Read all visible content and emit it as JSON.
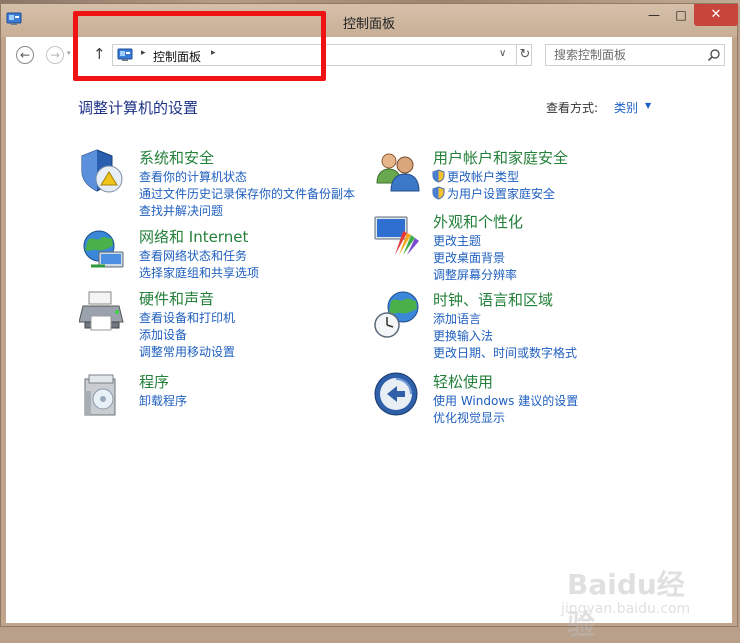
{
  "window": {
    "title": "控制面板",
    "minimize": "—",
    "maximize": "□",
    "close": "✕"
  },
  "navbar": {
    "back": "←",
    "forward": "→",
    "recent": "▾",
    "up": "↑",
    "breadcrumb": "控制面板",
    "separator": "▸",
    "dropdown": "∨",
    "refresh": "↻",
    "search_placeholder": "搜索控制面板"
  },
  "main": {
    "heading": "调整计算机的设置",
    "view_by_label": "查看方式:",
    "view_by_value": "类别",
    "view_by_arrow": "▼"
  },
  "categories": [
    {
      "title": "系统和安全",
      "links": [
        "查看你的计算机状态",
        "通过文件历史记录保存你的文件备份副本",
        "查找并解决问题"
      ]
    },
    {
      "title": "网络和 Internet",
      "links": [
        "查看网络状态和任务",
        "选择家庭组和共享选项"
      ]
    },
    {
      "title": "硬件和声音",
      "links": [
        "查看设备和打印机",
        "添加设备",
        "调整常用移动设置"
      ]
    },
    {
      "title": "程序",
      "links": [
        "卸载程序"
      ]
    },
    {
      "title": "用户帐户和家庭安全",
      "links": [
        "更改帐户类型",
        "为用户设置家庭安全"
      ]
    },
    {
      "title": "外观和个性化",
      "links": [
        "更改主题",
        "更改桌面背景",
        "调整屏幕分辨率"
      ]
    },
    {
      "title": "时钟、语言和区域",
      "links": [
        "添加语言",
        "更换输入法",
        "更改日期、时间或数字格式"
      ]
    },
    {
      "title": "轻松使用",
      "links": [
        "使用 Windows 建议的设置",
        "优化视觉显示"
      ]
    }
  ],
  "watermark": {
    "text": "Baidu经验",
    "sub": "jingyan.baidu.com"
  },
  "colors": {
    "highlight": "#f01313",
    "category_title": "#24803a",
    "link": "#1f5fbf",
    "heading": "#1e3287"
  }
}
